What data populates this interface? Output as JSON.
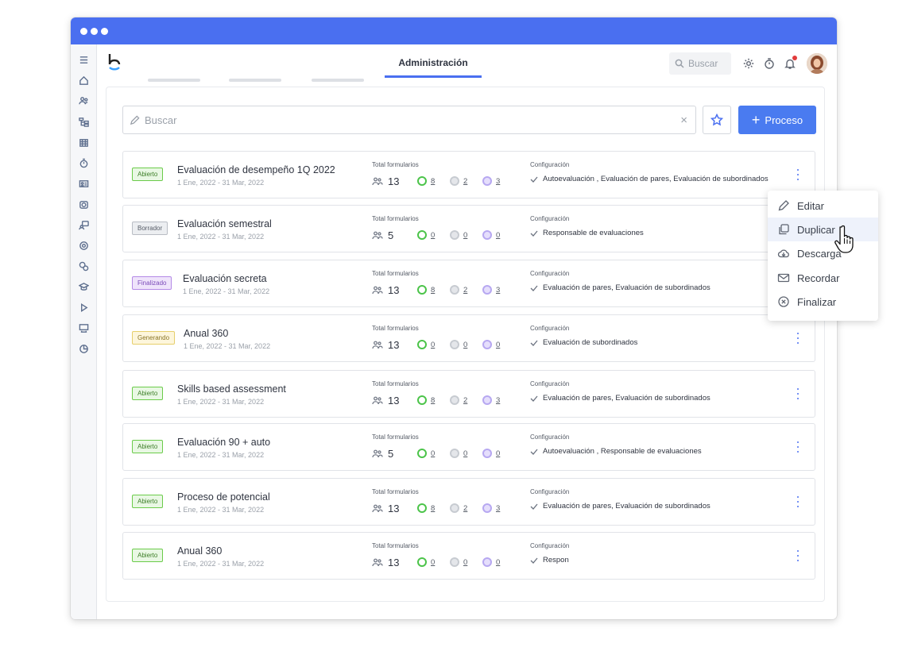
{
  "topbar": {
    "active_tab": "Administración",
    "search_placeholder": "Buscar"
  },
  "toolbar": {
    "search_placeholder": "Buscar",
    "clear": "×",
    "new_process_label": "Proceso",
    "new_process_plus": "+"
  },
  "labels": {
    "total": "Total formularios",
    "config": "Configuración"
  },
  "rows": [
    {
      "status": "Abierto",
      "status_kind": "open",
      "title": "Evaluación de desempeño 1Q 2022",
      "date": "1 Ene, 2022 - 31 Mar, 2022",
      "users": "13",
      "green": "8",
      "gray": "2",
      "purple": "3",
      "config": "Autoevaluación ,  Evaluación de pares, Evaluación de subordinados"
    },
    {
      "status": "Borrador",
      "status_kind": "draft",
      "title": "Evaluación semestral",
      "date": "1 Ene, 2022 - 31 Mar, 2022",
      "users": "5",
      "green": "0",
      "gray": "0",
      "purple": "0",
      "config": "Responsable de evaluaciones"
    },
    {
      "status": "Finalizado",
      "status_kind": "done",
      "title": "Evaluación secreta",
      "date": "1 Ene, 2022 - 31 Mar, 2022",
      "users": "13",
      "green": "8",
      "gray": "2",
      "purple": "3",
      "config": "Evaluación de pares, Evaluación de subordinados"
    },
    {
      "status": "Generando",
      "status_kind": "gen",
      "title": "Anual 360",
      "date": "1 Ene, 2022 - 31 Mar, 2022",
      "users": "13",
      "green": "0",
      "gray": "0",
      "purple": "0",
      "config": "Evaluación de subordinados"
    },
    {
      "status": "Abierto",
      "status_kind": "open",
      "title": "Skills based assessment",
      "date": "1 Ene, 2022 - 31 Mar, 2022",
      "users": "13",
      "green": "8",
      "gray": "2",
      "purple": "3",
      "config": "Evaluación de pares, Evaluación de subordinados"
    },
    {
      "status": "Abierto",
      "status_kind": "open",
      "title": "Evaluación 90 + auto",
      "date": "1 Ene, 2022 - 31 Mar, 2022",
      "users": "5",
      "green": "0",
      "gray": "0",
      "purple": "0",
      "config": "Autoevaluación ,  Responsable de evaluaciones"
    },
    {
      "status": "Abierto",
      "status_kind": "open",
      "title": "Proceso de potencial",
      "date": "1 Ene, 2022 - 31 Mar, 2022",
      "users": "13",
      "green": "8",
      "gray": "2",
      "purple": "3",
      "config": "Evaluación de pares, Evaluación de subordinados"
    },
    {
      "status": "Abierto",
      "status_kind": "open",
      "title": "Anual 360",
      "date": "1 Ene, 2022 - 31 Mar, 2022",
      "users": "13",
      "green": "0",
      "gray": "0",
      "purple": "0",
      "config": "Respon"
    }
  ],
  "context_menu": {
    "items": [
      {
        "label": "Editar",
        "icon": "pencil-icon"
      },
      {
        "label": "Duplicar",
        "icon": "copy-icon"
      },
      {
        "label": "Descarga",
        "icon": "cloud-download-icon"
      },
      {
        "label": "Recordar",
        "icon": "mail-icon"
      },
      {
        "label": "Finalizar",
        "icon": "x-circle-icon"
      }
    ]
  },
  "colors": {
    "accent": "#4a6ff0",
    "titlebar": "#4a6ff0",
    "open_badge": "#6bcb4a",
    "draft_badge": "#b9bdc4",
    "done_badge": "#b48ae6",
    "gen_badge": "#e6cf6c"
  }
}
